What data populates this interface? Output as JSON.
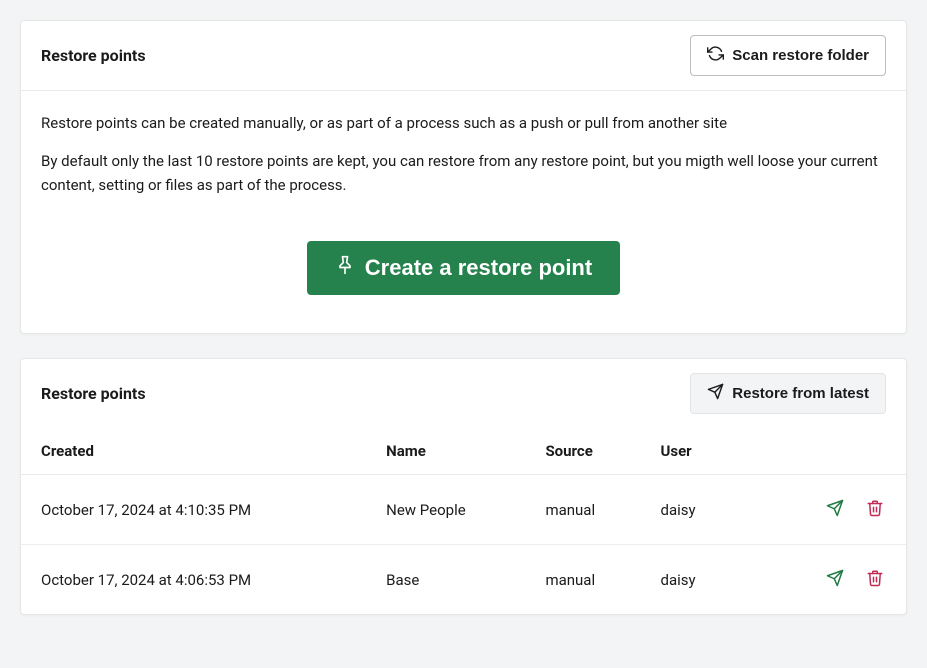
{
  "panel1": {
    "title": "Restore points",
    "scan_button": "Scan restore folder",
    "desc1": "Restore points can be created manually, or as part of a process such as a push or pull from another site",
    "desc2": "By default only the last 10 restore points are kept, you can restore from any restore point, but you migth well loose your current content, setting or files as part of the process.",
    "create_button": "Create a restore point"
  },
  "panel2": {
    "title": "Restore points",
    "restore_latest": "Restore from latest",
    "headers": {
      "created": "Created",
      "name": "Name",
      "source": "Source",
      "user": "User"
    },
    "rows": [
      {
        "created": "October 17, 2024 at 4:10:35 PM",
        "name": "New People",
        "source": "manual",
        "user": "daisy"
      },
      {
        "created": "October 17, 2024 at 4:06:53 PM",
        "name": "Base",
        "source": "manual",
        "user": "daisy"
      }
    ]
  },
  "colors": {
    "primary_green": "#26824d",
    "danger_red": "#c02c54",
    "action_green": "#1f7a43"
  }
}
